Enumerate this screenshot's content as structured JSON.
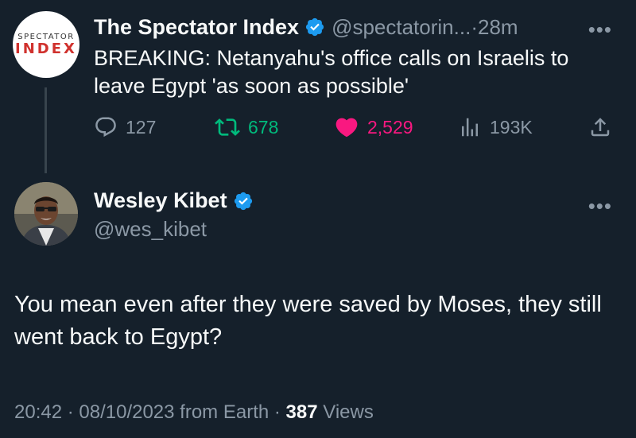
{
  "original_tweet": {
    "avatar_text_top": "SPECTATOR",
    "avatar_text_bottom": "INDEX",
    "display_name": "The Spectator Index",
    "handle": "@spectatorin...",
    "separator": "·",
    "time": "28m",
    "more": "•••",
    "text": "BREAKING: Netanyahu's office calls on Israelis to leave Egypt 'as soon as possible'",
    "stats": {
      "replies": "127",
      "retweets": "678",
      "likes": "2,529",
      "views": "193K"
    }
  },
  "reply_tweet": {
    "display_name": "Wesley Kibet",
    "handle": "@wes_kibet",
    "more": "•••",
    "text": "You mean even after they were saved by Moses, they still went back to Egypt?",
    "meta_time": "20:42 · 08/10/2023 from Earth · ",
    "meta_views_count": "387",
    "meta_views_label": " Views"
  },
  "colors": {
    "background": "#15202b",
    "text_primary": "#f7f9f9",
    "text_secondary": "#8b98a5",
    "verified": "#1d9bf0",
    "retweet": "#00ba7c",
    "like": "#f91880"
  },
  "icons": {
    "verified": "verified-badge-icon",
    "reply": "reply-icon",
    "retweet": "retweet-icon",
    "like": "heart-icon",
    "views": "views-icon",
    "share": "share-icon"
  }
}
